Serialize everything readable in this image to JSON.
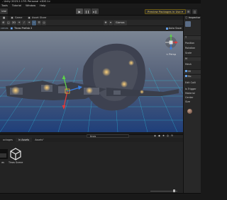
{
  "window": {
    "title": "- Unity 2023.2.17f1 Personal <DX11>"
  },
  "menu": [
    "Tools",
    "Tutorial",
    "Window",
    "Help"
  ],
  "toolbar": {
    "left_labels": [
      "ictol"
    ],
    "play_icons": [
      "▶",
      "❙❙",
      "▸❙"
    ],
    "packages_warning": "Preview Packages in Use ▾"
  },
  "tabs": {
    "game": "Game",
    "asset_store": "Asset Store"
  },
  "scene_toolbar": {
    "left_icons": [
      "⊞",
      "◫",
      "2D",
      "☀",
      "♪",
      "☀",
      "⬫",
      "☲",
      "◎"
    ],
    "gizmos_label": "Gizmos",
    "right_icons": [
      "✥",
      "▾"
    ]
  },
  "breadcrumb": {
    "root": "cenes",
    "prefab": "Tinas Prefab 2",
    "auto_save": "Auto Save"
  },
  "gizmo": {
    "persp_label": "< Persp"
  },
  "inspector": {
    "title": "Inspector",
    "rows": [
      "T",
      "Position",
      "Rotation",
      "Scale",
      "M",
      "Mesh",
      "Mi",
      "Bo",
      "Edit Colli",
      "Is Trigger",
      "Material",
      "Center",
      "Size"
    ]
  },
  "bottom": {
    "tabs": [
      "ackages",
      "In Assets",
      "Assets\""
    ],
    "search_value": "tinas",
    "filter_icons": [
      "◈",
      "◆",
      "★",
      "◎",
      "9"
    ],
    "assets": [
      {
        "name": "as"
      },
      {
        "name": "Tinas Scene"
      }
    ]
  },
  "colors": {
    "accent": "#3d7cc9",
    "warning": "#f4d35e",
    "grid": "#2bd7f2"
  }
}
